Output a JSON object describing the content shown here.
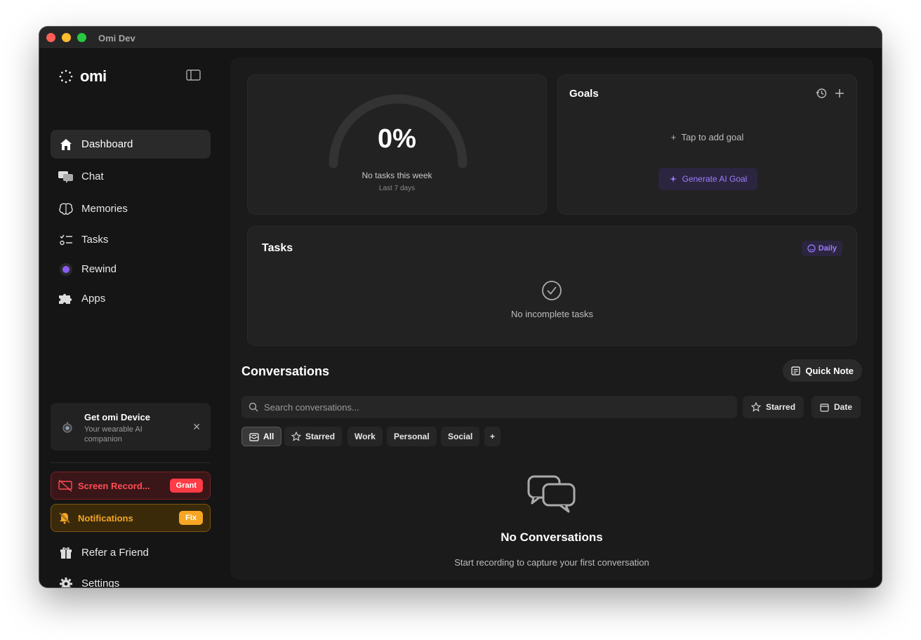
{
  "window": {
    "title": "Omi Dev"
  },
  "sidebar": {
    "logo": "omi",
    "items": [
      {
        "label": "Dashboard",
        "icon": "home-icon"
      },
      {
        "label": "Chat",
        "icon": "chat-icon"
      },
      {
        "label": "Memories",
        "icon": "brain-icon"
      },
      {
        "label": "Tasks",
        "icon": "tasks-icon"
      },
      {
        "label": "Rewind",
        "icon": "rewind-dot-icon"
      },
      {
        "label": "Apps",
        "icon": "puzzle-icon"
      }
    ],
    "promo": {
      "title": "Get omi Device",
      "subtitle": "Your wearable AI companion"
    },
    "permissions": [
      {
        "label": "Screen Record...",
        "badge": "Grant",
        "color": "#ff3b45"
      },
      {
        "label": "Notifications",
        "badge": "Fix",
        "color": "#f6a623"
      }
    ],
    "footer": [
      {
        "label": "Refer a Friend",
        "icon": "gift-icon"
      },
      {
        "label": "Settings",
        "icon": "gear-icon"
      }
    ]
  },
  "gauge": {
    "percent": "0%",
    "progress": 0,
    "subtitle": "No tasks this week",
    "period": "Last 7 days"
  },
  "goals": {
    "title": "Goals",
    "add_label": "Tap to add goal",
    "generate_label": "Generate AI Goal"
  },
  "tasks": {
    "title": "Tasks",
    "badge": "Daily",
    "empty": "No incomplete tasks"
  },
  "conversations": {
    "title": "Conversations",
    "quick_note": "Quick Note",
    "search_placeholder": "Search conversations...",
    "filters": {
      "starred": "Starred",
      "date": "Date"
    },
    "chips": [
      "All",
      "Starred",
      "Work",
      "Personal",
      "Social"
    ],
    "add_chip": "+",
    "empty_title": "No Conversations",
    "empty_subtitle": "Start recording to capture your first conversation"
  },
  "colors": {
    "accent": "#9d7dff",
    "danger": "#ff3b45",
    "warning": "#f6a623"
  }
}
